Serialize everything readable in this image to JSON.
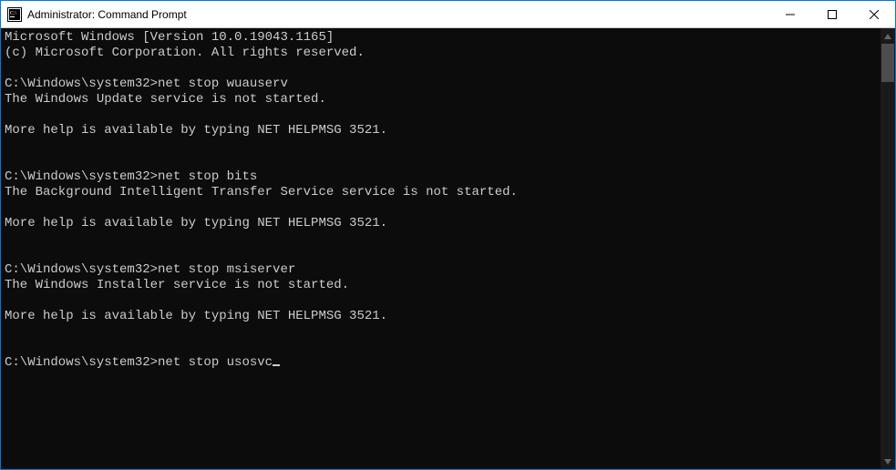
{
  "window": {
    "title": "Administrator: Command Prompt"
  },
  "terminal": {
    "lines": [
      "Microsoft Windows [Version 10.0.19043.1165]",
      "(c) Microsoft Corporation. All rights reserved.",
      "",
      "C:\\Windows\\system32>net stop wuauserv",
      "The Windows Update service is not started.",
      "",
      "More help is available by typing NET HELPMSG 3521.",
      "",
      "",
      "C:\\Windows\\system32>net stop bits",
      "The Background Intelligent Transfer Service service is not started.",
      "",
      "More help is available by typing NET HELPMSG 3521.",
      "",
      "",
      "C:\\Windows\\system32>net stop msiserver",
      "The Windows Installer service is not started.",
      "",
      "More help is available by typing NET HELPMSG 3521.",
      "",
      "",
      "C:\\Windows\\system32>net stop usosvc"
    ],
    "cursor_line_index": 21
  },
  "colors": {
    "border": "#0078d7",
    "terminal_bg": "#0c0c0c",
    "terminal_fg": "#cccccc"
  }
}
